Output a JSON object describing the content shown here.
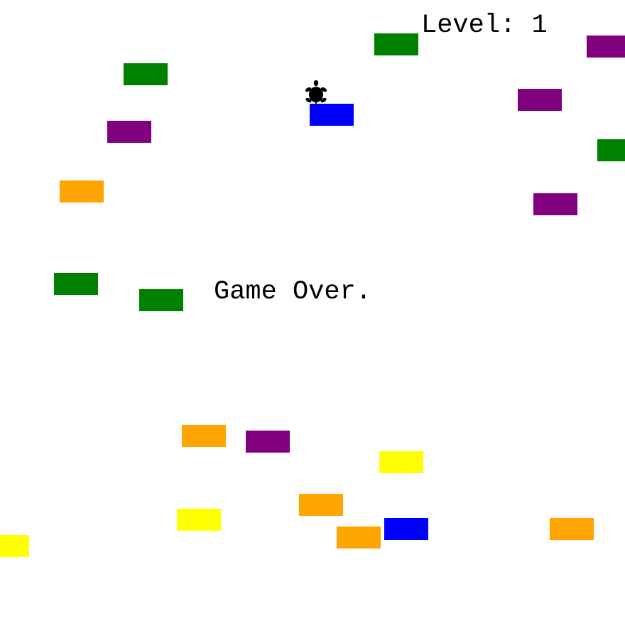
{
  "hud": {
    "level_label": "Level:",
    "level_value": "1",
    "game_over_text": "Game Over."
  },
  "player": {
    "icon": "turtle-icon",
    "color": "#000000"
  },
  "colors": {
    "green": "#008000",
    "purple": "#800080",
    "orange": "#ffa500",
    "yellow": "#ffff00",
    "blue": "#0000ff"
  },
  "cars": [
    {
      "color": "green"
    },
    {
      "color": "green"
    },
    {
      "color": "purple"
    },
    {
      "color": "purple"
    },
    {
      "color": "purple"
    },
    {
      "color": "blue"
    },
    {
      "color": "green"
    },
    {
      "color": "orange"
    },
    {
      "color": "purple"
    },
    {
      "color": "green"
    },
    {
      "color": "green"
    },
    {
      "color": "orange"
    },
    {
      "color": "purple"
    },
    {
      "color": "yellow"
    },
    {
      "color": "orange"
    },
    {
      "color": "yellow"
    },
    {
      "color": "orange"
    },
    {
      "color": "blue"
    },
    {
      "color": "orange"
    },
    {
      "color": "yellow"
    }
  ]
}
